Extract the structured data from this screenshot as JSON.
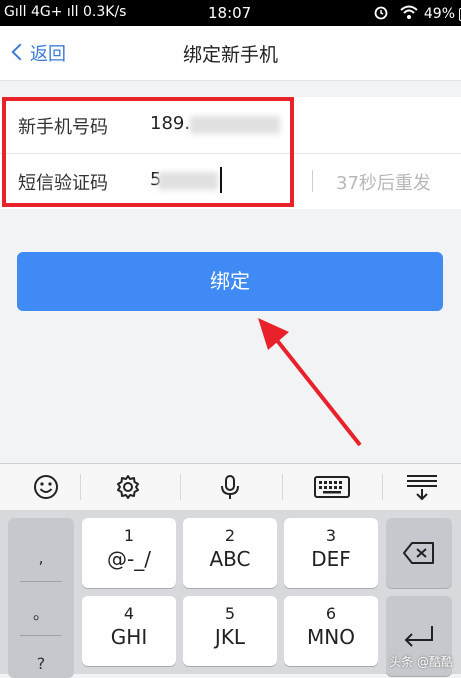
{
  "status_bar": {
    "left": "Gıll 4G+ ıll 0.3K/s",
    "time": "18:07",
    "battery": "49%"
  },
  "nav": {
    "back_label": "返回",
    "title": "绑定新手机"
  },
  "form": {
    "phone_label": "新手机号码",
    "phone_value": "189.",
    "code_label": "短信验证码",
    "code_value": "5",
    "resend_text": "37秒后重发"
  },
  "bind_button_label": "绑定",
  "keyboard": {
    "punctuation": [
      ",",
      "。",
      "?"
    ],
    "keys": [
      {
        "num": "1",
        "letters": "@-_/"
      },
      {
        "num": "2",
        "letters": "ABC"
      },
      {
        "num": "3",
        "letters": "DEF"
      },
      {
        "num": "4",
        "letters": "GHI"
      },
      {
        "num": "5",
        "letters": "JKL"
      },
      {
        "num": "6",
        "letters": "MNO"
      }
    ],
    "toolbar_icons": [
      "emoji-icon",
      "settings-icon",
      "microphone-icon",
      "keyboard-icon",
      "collapse-keyboard-icon"
    ]
  },
  "watermark": "头条 @酷酷",
  "colors": {
    "accent": "#3f8af5",
    "back_link": "#3d7bd8",
    "highlight": "#e8212b"
  }
}
